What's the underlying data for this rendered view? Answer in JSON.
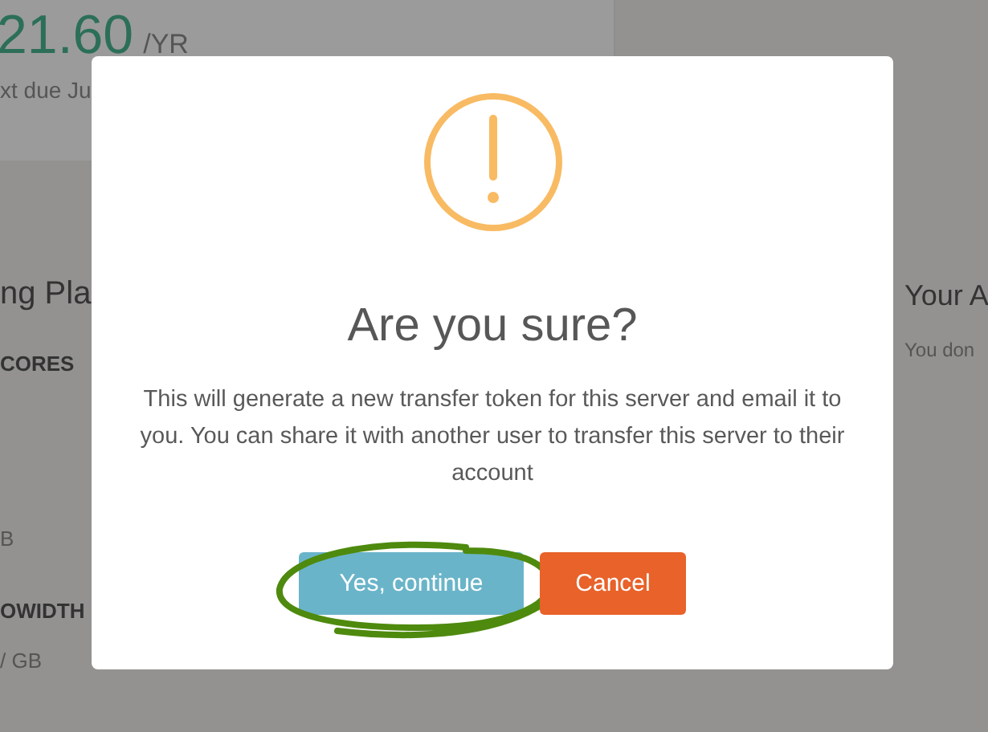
{
  "background": {
    "price": "21.60",
    "price_unit": "/YR",
    "due_text": "xt due Ju",
    "plan_heading": "ng Pla",
    "cores_label": "CORES",
    "memory_value": "B",
    "bandwidth_label": "OWIDTH",
    "bandwidth_value": "/ GB",
    "right_heading": "Your A",
    "right_text": "You don"
  },
  "dialog": {
    "title": "Are you sure?",
    "message": "This will generate a new transfer token for this server and email it to you. You can share it with another user to transfer this server to their account",
    "buttons": [
      {
        "label": "Yes, continue",
        "kind": "confirm",
        "highlighted": true
      },
      {
        "label": "Cancel",
        "kind": "cancel",
        "highlighted": false
      }
    ]
  }
}
